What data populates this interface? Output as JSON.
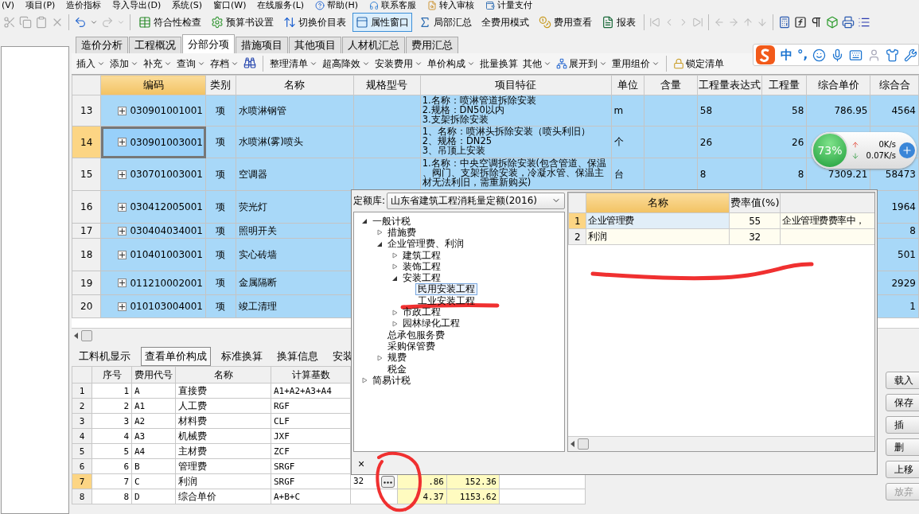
{
  "menu": [
    {
      "label": "(V)",
      "kind": "text"
    },
    {
      "label": "项目(P)",
      "kind": "text"
    },
    {
      "label": "造价指标",
      "kind": "text"
    },
    {
      "label": "导入导出(D)",
      "kind": "text"
    },
    {
      "label": "系统(S)",
      "kind": "text"
    },
    {
      "label": "窗口(W)",
      "kind": "text"
    },
    {
      "label": "在线服务(L)",
      "kind": "text"
    },
    {
      "label": "帮助(H)",
      "kind": "help"
    },
    {
      "label": "联系客服",
      "kind": "service"
    },
    {
      "label": "转入审核",
      "kind": "audit"
    },
    {
      "label": "计量支付",
      "kind": "pay"
    }
  ],
  "toolbar": [
    {
      "label": "符合性检查",
      "kind": "check",
      "selected": false
    },
    {
      "label": "预算书设置",
      "kind": "settings",
      "selected": false
    },
    {
      "label": "切换价目表",
      "kind": "switch",
      "selected": false
    },
    {
      "label": "属性窗口",
      "kind": "window",
      "selected": true
    },
    {
      "label": "局部汇总",
      "kind": "sum",
      "selected": false
    },
    {
      "label": "全费用模式",
      "kind": "text",
      "selected": false
    },
    {
      "label": "费用查看",
      "kind": "coins",
      "selected": false
    },
    {
      "label": "报表",
      "kind": "report",
      "selected": false
    }
  ],
  "tabs": [
    {
      "label": "造价分析",
      "selected": false
    },
    {
      "label": "工程概况",
      "selected": false
    },
    {
      "label": "分部分项",
      "selected": true
    },
    {
      "label": "措施项目",
      "selected": false
    },
    {
      "label": "其他项目",
      "selected": false
    },
    {
      "label": "人材机汇总",
      "selected": false
    },
    {
      "label": "费用汇总",
      "selected": false
    }
  ],
  "sub_toolbar": [
    {
      "kind": "text",
      "label": "插入",
      "dropdown": true
    },
    {
      "kind": "text",
      "label": "添加",
      "dropdown": true
    },
    {
      "kind": "text",
      "label": "补充",
      "dropdown": true
    },
    {
      "kind": "text",
      "label": "查询",
      "dropdown": true
    },
    {
      "kind": "text",
      "label": "存档",
      "dropdown": true
    },
    {
      "kind": "find"
    },
    {
      "kind": "separator"
    },
    {
      "kind": "text",
      "label": "整理清单",
      "dropdown": true
    },
    {
      "kind": "text",
      "label": "超高降效",
      "dropdown": true
    },
    {
      "kind": "text",
      "label": "安装费用",
      "dropdown": true
    },
    {
      "kind": "text",
      "label": "单价构成",
      "dropdown": true
    },
    {
      "kind": "text",
      "label": "批量换算",
      "dropdown": false
    },
    {
      "kind": "text",
      "label": "其他",
      "dropdown": true
    },
    {
      "kind": "tree",
      "label": "展开到",
      "dropdown": true
    },
    {
      "kind": "text",
      "label": "重用组价",
      "dropdown": true
    },
    {
      "kind": "separator"
    },
    {
      "kind": "lock",
      "label": "锁定清单",
      "dropdown": false
    }
  ],
  "grid": {
    "columns": [
      {
        "selected": false
      },
      {
        "label": "编码",
        "selected": true
      },
      {
        "label": "类别",
        "selected": false
      },
      {
        "label": "名称",
        "selected": false
      },
      {
        "label": "规格型号",
        "selected": false
      },
      {
        "label": "项目特征",
        "selected": false
      },
      {
        "label": "单位",
        "selected": false
      },
      {
        "label": "含量",
        "selected": false
      },
      {
        "label": "工程量表达式",
        "selected": false
      },
      {
        "label": "工程量",
        "selected": false
      },
      {
        "label": "综合单价",
        "selected": false
      },
      {
        "label": "综合合",
        "selected": false
      }
    ],
    "rows": [
      {
        "num": "13",
        "code": "030901001001",
        "type": "项",
        "name": "水喷淋钢管",
        "features": [
          "1.名称：喷淋管道拆除安装",
          "2.规格：DN50以内",
          "3.支架拆除安装"
        ],
        "unit": "m",
        "expr": "58",
        "qty": "58",
        "price": "786.95",
        "total": "4564",
        "selected": false
      },
      {
        "num": "14",
        "code": "030901003001",
        "type": "项",
        "name": "水喷淋(雾)喷头",
        "features": [
          "1、名称：喷淋头拆除安装（喷头利旧）",
          "2、规格：DN25",
          "3、吊顶上安装"
        ],
        "unit": "个",
        "expr": "26",
        "qty": "26",
        "selected": true
      },
      {
        "num": "15",
        "code": "030701003001",
        "type": "项",
        "name": "空调器",
        "features": [
          "1.名称：中央空调拆除安装(包含管道、保温",
          "、阀门、支架拆除安装，冷凝水管、保温主",
          "材无法利旧，需重新购买)"
        ],
        "unit": "台",
        "expr": "8",
        "qty": "8",
        "price": "7309.21",
        "total": "58473",
        "selected": false
      },
      {
        "num": "16",
        "code": "030412005001",
        "type": "项",
        "name": "荧光灯",
        "total": "1964",
        "selected": false
      },
      {
        "num": "17",
        "code": "030404034001",
        "type": "项",
        "name": "照明开关",
        "total": "8",
        "selected": false
      },
      {
        "num": "18",
        "code": "010401003001",
        "type": "项",
        "name": "实心砖墙",
        "total": "501",
        "selected": false
      },
      {
        "num": "19",
        "code": "011210002001",
        "type": "项",
        "name": "金属隔断",
        "total": "2929",
        "selected": false
      },
      {
        "num": "20",
        "code": "010103004001",
        "type": "项",
        "name": "竣工清理",
        "total": "1",
        "selected": false
      }
    ]
  },
  "bottom_tabs": [
    {
      "label": "工料机显示",
      "selected": false
    },
    {
      "label": "查看单价构成",
      "selected": true
    },
    {
      "label": "标准换算",
      "selected": false
    },
    {
      "label": "换算信息",
      "selected": false
    },
    {
      "label": "安装",
      "selected": false
    }
  ],
  "cost_grid": {
    "columns": [
      "序号",
      "费用代号",
      "名称",
      "计算基数"
    ],
    "rows": [
      {
        "row": "1",
        "seq": "1",
        "code": "A",
        "name": "直接费",
        "base": "A1+A2+A3+A4",
        "selected": false
      },
      {
        "row": "2",
        "seq": "2",
        "code": "A1",
        "name": "人工费",
        "base": "RGF",
        "selected": false
      },
      {
        "row": "3",
        "seq": "3",
        "code": "A2",
        "name": "材料费",
        "base": "CLF",
        "selected": false
      },
      {
        "row": "4",
        "seq": "4",
        "code": "A3",
        "name": "机械费",
        "base": "JXF",
        "selected": false
      },
      {
        "row": "5",
        "seq": "5",
        "code": "A4",
        "name": "主材费",
        "base": "ZCF",
        "selected": false
      },
      {
        "row": "6",
        "seq": "6",
        "code": "B",
        "name": "管理费",
        "base": "SRGF",
        "selected": false
      },
      {
        "row": "7",
        "seq": "7",
        "code": "C",
        "name": "利润",
        "base": "SRGF",
        "rate": "32",
        "unit_price": ".86",
        "amount": "152.36",
        "selected": true
      },
      {
        "row": "8",
        "seq": "8",
        "code": "D",
        "name": "综合单价",
        "base": "A+B+C",
        "unit_price": "4.37",
        "amount": "1153.62",
        "selected": false
      }
    ]
  },
  "side_buttons": [
    {
      "label": "载入",
      "disabled": false
    },
    {
      "label": "保存",
      "disabled": false
    },
    {
      "label": "插",
      "disabled": false
    },
    {
      "label": "删",
      "disabled": false
    },
    {
      "label": "上移",
      "disabled": false
    },
    {
      "label": "放弃",
      "disabled": true
    }
  ],
  "popup": {
    "library_label": "定额库:",
    "library": "山东省建筑工程消耗量定额(2016)",
    "tree": [
      {
        "label": "一般计税",
        "kind": "branch",
        "expanded": true,
        "children": [
          {
            "label": "措施费",
            "kind": "branch",
            "expanded": false
          },
          {
            "label": "企业管理费、利润",
            "kind": "branch",
            "expanded": true,
            "children": [
              {
                "label": "建筑工程",
                "kind": "branch",
                "expanded": false
              },
              {
                "label": "装饰工程",
                "kind": "branch",
                "expanded": false
              },
              {
                "label": "安装工程",
                "kind": "branch",
                "expanded": true,
                "children": [
                  {
                    "label": "民用安装工程",
                    "kind": "leaf",
                    "selected": true
                  },
                  {
                    "label": "工业安装工程",
                    "kind": "leaf",
                    "selected": false
                  }
                ]
              },
              {
                "label": "市政工程",
                "kind": "branch",
                "expanded": false
              },
              {
                "label": "园林绿化工程",
                "kind": "branch",
                "expanded": false
              }
            ]
          },
          {
            "label": "总承包服务费",
            "kind": "leaf",
            "selected": false
          },
          {
            "label": "采购保管费",
            "kind": "leaf",
            "selected": false
          },
          {
            "label": "规费",
            "kind": "branch",
            "expanded": false
          },
          {
            "label": "税金",
            "kind": "leaf",
            "selected": false
          }
        ]
      },
      {
        "label": "简易计税",
        "kind": "branch",
        "expanded": false
      }
    ],
    "rate_columns": [
      "名称",
      "费率值(%)"
    ],
    "rates": [
      {
        "num": "1",
        "name": "企业管理费",
        "rate": "55",
        "note": "企业管理费费率中，",
        "selected": true
      },
      {
        "num": "2",
        "name": "利润",
        "rate": "32",
        "selected": false
      }
    ],
    "close": "×"
  },
  "network_widget": {
    "percent": "73%",
    "up": "0K/s",
    "down": "0.07K/s"
  },
  "ime_bar": {
    "mode": "中",
    "punct": "°,"
  }
}
